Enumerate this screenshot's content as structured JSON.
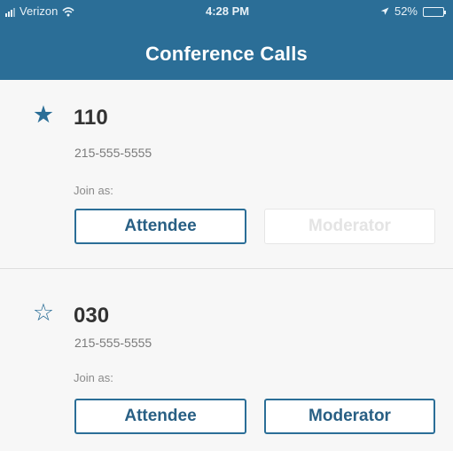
{
  "status_bar": {
    "carrier": "Verizon",
    "time": "4:28 PM",
    "battery": "52%",
    "battery_level": 0.52,
    "icons": [
      "signal-bars-icon",
      "wifi-icon",
      "location-arrow-icon",
      "battery-icon"
    ]
  },
  "header": {
    "title": "Conference Calls",
    "background_color": "#2b6e97"
  },
  "calls": [
    {
      "favorite": true,
      "star_icon": "filled-star-icon",
      "name": "110",
      "phone": "215-555-5555",
      "join_label": "Join as:",
      "attendee_label": "Attendee",
      "moderator_label": "Moderator",
      "moderator_enabled": false
    },
    {
      "favorite": false,
      "star_icon": "outline-star-icon",
      "name": "030",
      "phone": "215-555-5555",
      "join_label": "Join as:",
      "attendee_label": "Attendee",
      "moderator_label": "Moderator",
      "moderator_enabled": true
    }
  ],
  "colors": {
    "accent": "#2b6e97",
    "disabled_text": "#e4e4e4"
  }
}
